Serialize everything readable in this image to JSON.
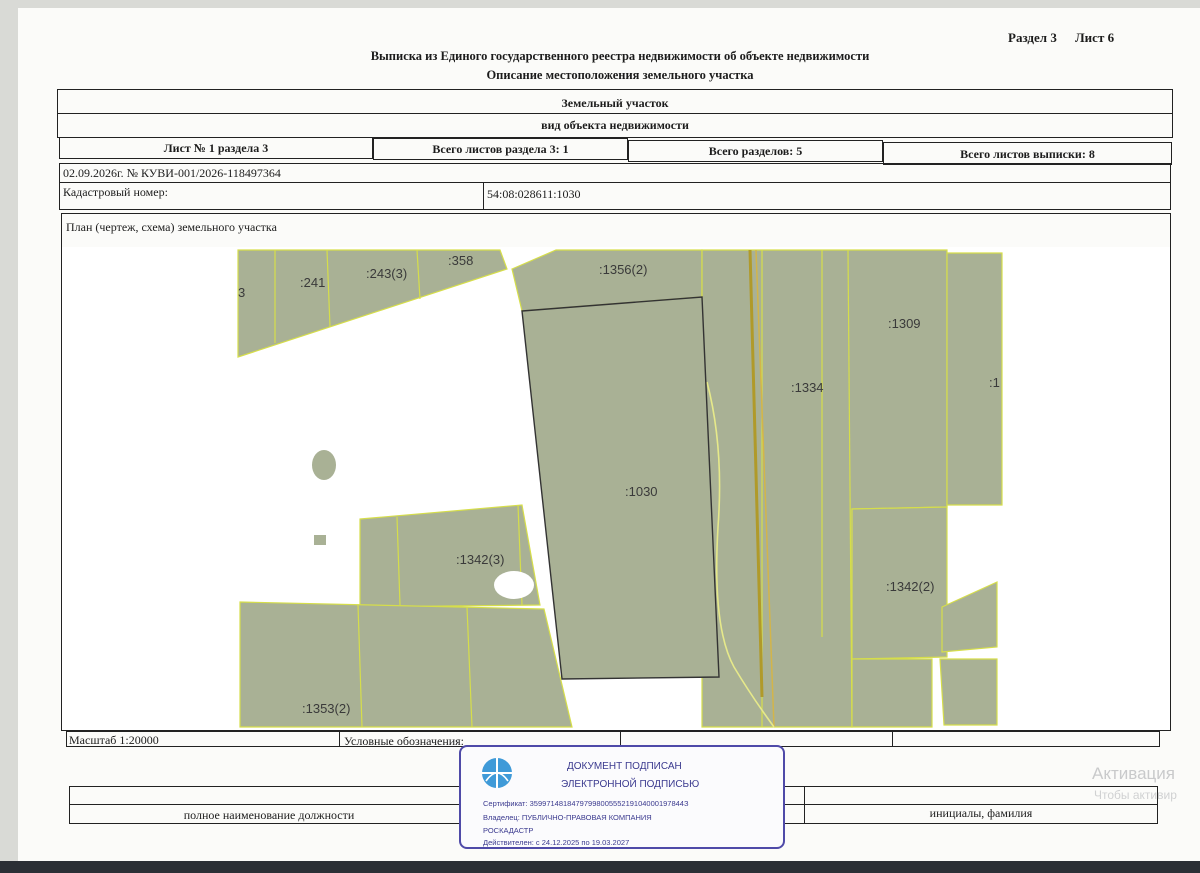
{
  "header": {
    "section_label": "Раздел 3",
    "sheet_label": "Лист 6",
    "title": "Выписка из Единого государственного реестра недвижимости об объекте недвижимости",
    "subtitle": "Описание местоположения земельного участка"
  },
  "object": {
    "type": "Земельный участок",
    "type_caption": "вид объекта недвижимости"
  },
  "sheet_info": {
    "sheet_of_section": "Лист № 1 раздела 3",
    "total_sheets_section": "Всего листов раздела 3: 1",
    "total_sections": "Всего разделов: 5",
    "total_sheets_extract": "Всего листов выписки: 8"
  },
  "record": {
    "date_number": "02.09.2026г. № КУВИ-001/2026-118497364",
    "cadastral_label": "Кадастровый номер:",
    "cadastral_number": "54:08:028611:1030"
  },
  "plan": {
    "caption": "План (чертеж, схема) земельного участка",
    "parcels": [
      ":241",
      ":243(3)",
      ":358",
      ":1356(2)",
      ":1309",
      ":1334",
      ":1030",
      ":1342(3)",
      ":1342(2)",
      ":1353(2)",
      "3",
      ":1"
    ]
  },
  "legend": {
    "scale": "Масштаб 1:20000",
    "symbols_label": "Условные обозначения:"
  },
  "signature": {
    "position_caption": "полное наименование должности",
    "name_caption": "инициалы, фамилия"
  },
  "stamp": {
    "line1": "ДОКУМЕНТ ПОДПИСАН",
    "line2": "ЭЛЕКТРОННОЙ ПОДПИСЬЮ",
    "certificate": "Сертификат: 3599714818479799800555219104000197844З",
    "owner": "Владелец: ПУБЛИЧНО-ПРАВОВАЯ КОМПАНИЯ",
    "owner2": "РОСКАДАСТР",
    "valid": "Действителен: с 24.12.2025 по 19.03.2027"
  },
  "watermark": {
    "line1": "Активация",
    "line2": "Чтобы активир"
  },
  "colors": {
    "parcel_fill": "#a9b195",
    "parcel_border": "#d6de4a",
    "main_parcel_border": "#333333",
    "road": "#b09a2a",
    "stamp": "#4f4aa8"
  }
}
